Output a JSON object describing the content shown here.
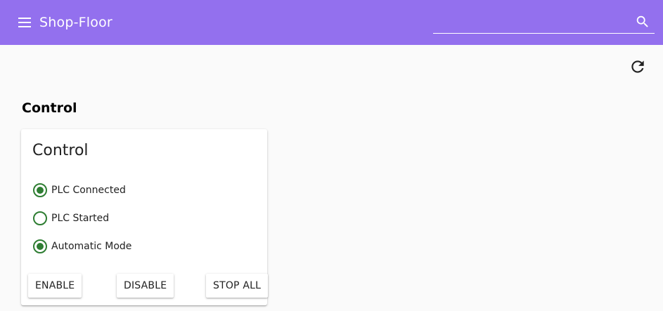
{
  "app": {
    "title": "Shop-Floor"
  },
  "header": {
    "menu_icon": "menu-icon",
    "search_icon": "search-icon",
    "search_value": "",
    "search_placeholder": ""
  },
  "toolbar": {
    "refresh_icon": "refresh-icon"
  },
  "section": {
    "heading": "Control"
  },
  "card": {
    "title": "Control",
    "statuses": [
      {
        "label": "PLC Connected",
        "checked": true
      },
      {
        "label": "PLC Started",
        "checked": false
      },
      {
        "label": "Automatic Mode",
        "checked": true
      }
    ],
    "buttons": {
      "enable": "ENABLE",
      "disable": "DISABLE",
      "stop_all": "STOP ALL"
    }
  },
  "colors": {
    "appbar": "#9370ee",
    "status_green": "#2e7d32",
    "background": "#fafafa"
  }
}
